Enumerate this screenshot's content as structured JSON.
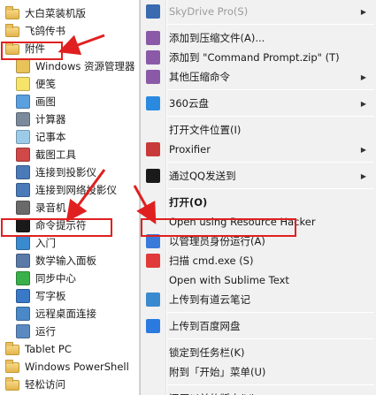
{
  "left_menu": {
    "items": [
      {
        "label": "大白菜装机版",
        "icon": "folder-icon",
        "color": "#e3b54c"
      },
      {
        "label": "飞鸽传书",
        "icon": "folder-icon",
        "color": "#e3b54c"
      },
      {
        "label": "附件",
        "icon": "folder-icon",
        "color": "#e3b54c"
      },
      {
        "label": "Windows 资源管理器",
        "icon": "explorer-icon",
        "color": "#e8c35a"
      },
      {
        "label": "便笺",
        "icon": "sticky-notes-icon",
        "color": "#f5e36a"
      },
      {
        "label": "画图",
        "icon": "paint-icon",
        "color": "#5aa0e0"
      },
      {
        "label": "计算器",
        "icon": "calculator-icon",
        "color": "#7a8a9a"
      },
      {
        "label": "记事本",
        "icon": "notepad-icon",
        "color": "#9ccbe8"
      },
      {
        "label": "截图工具",
        "icon": "snipping-tool-icon",
        "color": "#d04848"
      },
      {
        "label": "连接到投影仪",
        "icon": "projector-icon",
        "color": "#4a7ab8"
      },
      {
        "label": "连接到网络投影仪",
        "icon": "network-projector-icon",
        "color": "#4a7ab8"
      },
      {
        "label": "录音机",
        "icon": "sound-recorder-icon",
        "color": "#6a6a6a"
      },
      {
        "label": "命令提示符",
        "icon": "command-prompt-icon",
        "color": "#1a1a1a"
      },
      {
        "label": "入门",
        "icon": "getting-started-icon",
        "color": "#3a8ad0"
      },
      {
        "label": "数学输入面板",
        "icon": "math-input-icon",
        "color": "#5a7aa8"
      },
      {
        "label": "同步中心",
        "icon": "sync-center-icon",
        "color": "#3ab04a"
      },
      {
        "label": "写字板",
        "icon": "wordpad-icon",
        "color": "#3a78c8"
      },
      {
        "label": "远程桌面连接",
        "icon": "remote-desktop-icon",
        "color": "#4a88c8"
      },
      {
        "label": "运行",
        "icon": "run-icon",
        "color": "#5a8ac0"
      },
      {
        "label": "Tablet PC",
        "icon": "folder-icon",
        "color": "#e3b54c"
      },
      {
        "label": "Windows PowerShell",
        "icon": "folder-icon",
        "color": "#e3b54c"
      },
      {
        "label": "轻松访问",
        "icon": "folder-icon",
        "color": "#e3b54c"
      }
    ]
  },
  "context_menu": {
    "items": [
      {
        "label": "SkyDrive Pro(S)",
        "icon": "skydrive-icon",
        "color": "#3a6ab0",
        "disabled": true,
        "submenu": true
      },
      {
        "sep": true
      },
      {
        "label": "添加到压缩文件(A)...",
        "icon": "archive-icon",
        "color": "#8a5aa8"
      },
      {
        "label": "添加到 \"Command Prompt.zip\" (T)",
        "icon": "archive-icon",
        "color": "#8a5aa8"
      },
      {
        "label": "其他压缩命令",
        "icon": "archive-icon",
        "color": "#8a5aa8",
        "submenu": true
      },
      {
        "sep": true
      },
      {
        "label": "360云盘",
        "icon": "cloud-360-icon",
        "color": "#2a8ae0",
        "submenu": true
      },
      {
        "sep": true
      },
      {
        "label": "打开文件位置(I)"
      },
      {
        "label": "Proxifier",
        "icon": "proxifier-icon",
        "color": "#c83a3a",
        "submenu": true
      },
      {
        "sep": true
      },
      {
        "label": "通过QQ发送到",
        "icon": "qq-icon",
        "color": "#1a1a1a",
        "submenu": true
      },
      {
        "sep": true
      },
      {
        "label": "打开(O)",
        "bold": true
      },
      {
        "label": "Open using Resource Hacker"
      },
      {
        "label": "以管理员身份运行(A)",
        "icon": "uac-shield-icon",
        "color": "#3a7ad8"
      },
      {
        "label": "扫描 cmd.exe (S)",
        "icon": "scan-icon",
        "color": "#e03a3a"
      },
      {
        "label": "Open with Sublime Text"
      },
      {
        "label": "上传到有道云笔记",
        "icon": "youdao-note-icon",
        "color": "#3a8ad0"
      },
      {
        "sep": true
      },
      {
        "label": "上传到百度网盘",
        "icon": "baidu-netdisk-icon",
        "color": "#2a7ae0"
      },
      {
        "sep": true
      },
      {
        "label": "锁定到任务栏(K)"
      },
      {
        "label": "附到「开始」菜单(U)"
      },
      {
        "sep": true
      },
      {
        "label": "还原以前的版本(V)"
      }
    ]
  },
  "colors": {
    "highlight": "#e02020"
  }
}
